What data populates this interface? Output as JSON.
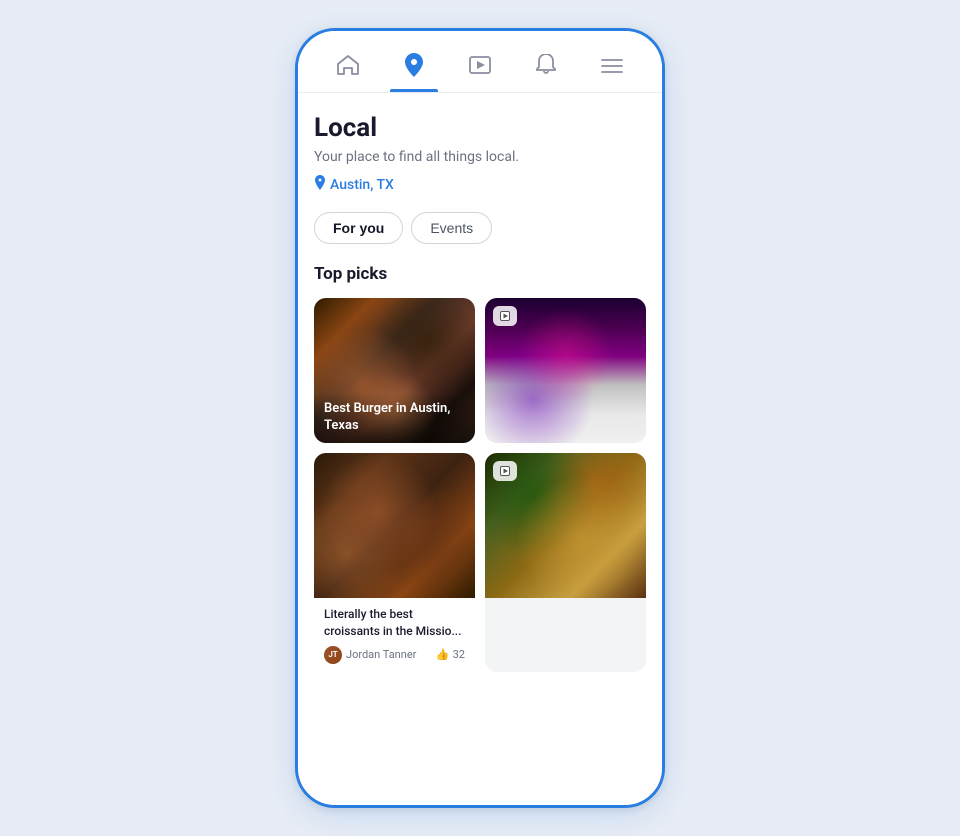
{
  "nav": {
    "items": [
      {
        "name": "home",
        "icon": "⌂",
        "label": "Home",
        "active": false
      },
      {
        "name": "local",
        "icon": "📍",
        "label": "Local",
        "active": true
      },
      {
        "name": "video",
        "icon": "▶",
        "label": "Video",
        "active": false
      },
      {
        "name": "bell",
        "icon": "🔔",
        "label": "Notifications",
        "active": false
      },
      {
        "name": "menu",
        "icon": "☰",
        "label": "Menu",
        "active": false
      }
    ]
  },
  "page": {
    "title": "Local",
    "subtitle": "Your place to find all things local.",
    "location": "Austin, TX"
  },
  "tabs": [
    {
      "id": "for-you",
      "label": "For you",
      "active": true
    },
    {
      "id": "events",
      "label": "Events",
      "active": false
    }
  ],
  "section": {
    "title": "Top picks"
  },
  "cards": [
    {
      "id": "burger",
      "type": "video",
      "image_class": "img-burger",
      "caption": "Best Burger in Austin, Texas",
      "has_overlay_caption": true,
      "has_video_badge": false,
      "text": "",
      "author": "",
      "likes": ""
    },
    {
      "id": "fashion",
      "type": "video",
      "image_class": "img-fashion",
      "caption": "",
      "has_overlay_caption": false,
      "has_video_badge": true,
      "text": "",
      "author": "",
      "likes": ""
    },
    {
      "id": "croissant",
      "type": "text",
      "image_class": "img-food",
      "caption": "",
      "has_overlay_caption": false,
      "has_video_badge": false,
      "text": "Literally the best croissants in the Missio...",
      "author": "Jordan Tanner",
      "likes": "32"
    },
    {
      "id": "sandwich",
      "type": "video",
      "image_class": "img-sandwich",
      "caption": "",
      "has_overlay_caption": false,
      "has_video_badge": true,
      "text": "",
      "author": "",
      "likes": ""
    }
  ],
  "icons": {
    "home": "⌂",
    "location_pin": "📍",
    "video": "▶",
    "bell": "🔔",
    "menu": "☰",
    "thumbsup": "👍",
    "video_badge": "▶"
  }
}
